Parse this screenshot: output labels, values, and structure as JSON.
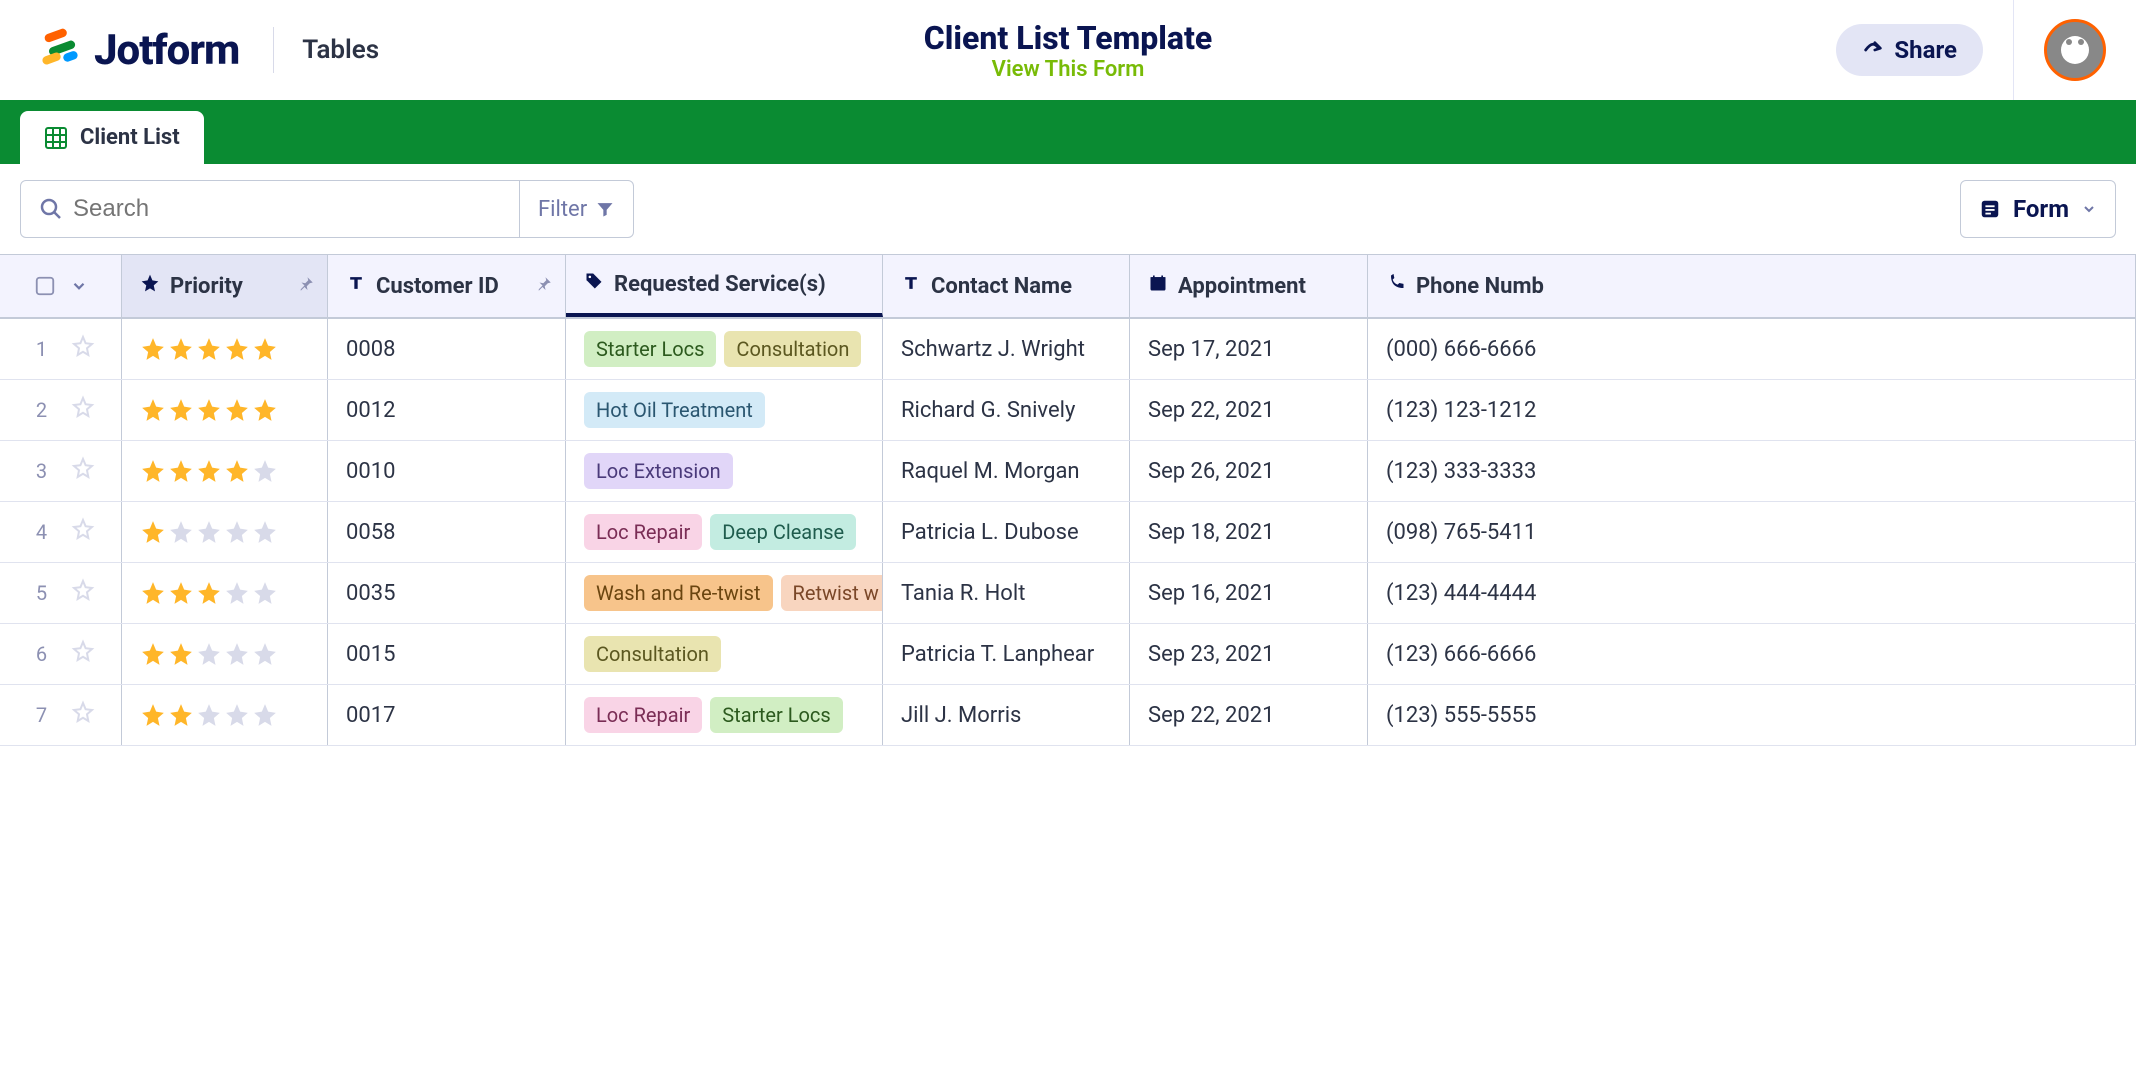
{
  "header": {
    "brand": "Jotform",
    "nav_tables": "Tables",
    "title": "Client List Template",
    "view_form": "View This Form",
    "share": "Share"
  },
  "tabs": {
    "active": "Client List"
  },
  "toolbar": {
    "search_placeholder": "Search",
    "filter": "Filter",
    "form": "Form"
  },
  "columns": {
    "priority": "Priority",
    "customer_id": "Customer ID",
    "services": "Requested Service(s)",
    "contact": "Contact Name",
    "appointment": "Appointment",
    "phone": "Phone Numb"
  },
  "service_colors": {
    "Starter Locs": "tag-green",
    "Consultation": "tag-olive",
    "Hot Oil Treatment": "tag-blue",
    "Loc Extension": "tag-purple",
    "Loc Repair": "tag-pink",
    "Deep Cleanse": "tag-teal",
    "Wash and Re-twist": "tag-orange",
    "Retwist w": "tag-peach"
  },
  "rows": [
    {
      "n": "1",
      "priority": 5,
      "customer_id": "0008",
      "services": [
        "Starter Locs",
        "Consultation"
      ],
      "contact": "Schwartz J. Wright",
      "appointment": "Sep 17, 2021",
      "phone": "(000) 666-6666"
    },
    {
      "n": "2",
      "priority": 5,
      "customer_id": "0012",
      "services": [
        "Hot Oil Treatment"
      ],
      "contact": "Richard G. Snively",
      "appointment": "Sep 22, 2021",
      "phone": "(123) 123-1212"
    },
    {
      "n": "3",
      "priority": 4,
      "customer_id": "0010",
      "services": [
        "Loc Extension"
      ],
      "contact": "Raquel M. Morgan",
      "appointment": "Sep 26, 2021",
      "phone": "(123) 333-3333"
    },
    {
      "n": "4",
      "priority": 1,
      "customer_id": "0058",
      "services": [
        "Loc Repair",
        "Deep Cleanse"
      ],
      "contact": "Patricia L. Dubose",
      "appointment": "Sep 18, 2021",
      "phone": "(098) 765-5411"
    },
    {
      "n": "5",
      "priority": 3,
      "customer_id": "0035",
      "services": [
        "Wash and Re-twist",
        "Retwist w"
      ],
      "contact": "Tania R. Holt",
      "appointment": "Sep 16, 2021",
      "phone": "(123) 444-4444"
    },
    {
      "n": "6",
      "priority": 2,
      "customer_id": "0015",
      "services": [
        "Consultation"
      ],
      "contact": "Patricia T. Lanphear",
      "appointment": "Sep 23, 2021",
      "phone": "(123) 666-6666"
    },
    {
      "n": "7",
      "priority": 2,
      "customer_id": "0017",
      "services": [
        "Loc Repair",
        "Starter Locs"
      ],
      "contact": "Jill J. Morris",
      "appointment": "Sep 22, 2021",
      "phone": "(123) 555-5555"
    }
  ]
}
